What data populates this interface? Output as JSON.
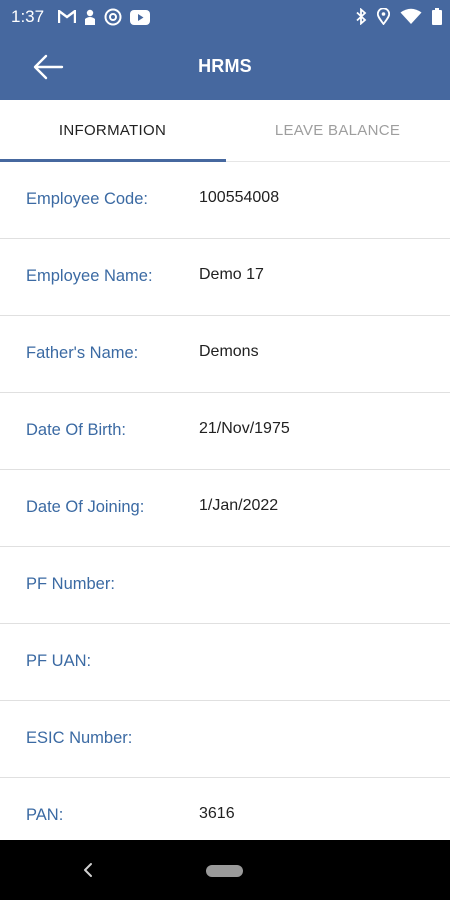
{
  "status_bar": {
    "time": "1:37",
    "left_icons": [
      "gmail-icon",
      "person-icon",
      "at-sign-icon",
      "youtube-icon"
    ],
    "right_icons": [
      "bluetooth-icon",
      "location-icon",
      "wifi-icon",
      "battery-icon"
    ]
  },
  "app_bar": {
    "title": "HRMS",
    "back_icon": "arrow-left-icon",
    "color": "#46689f"
  },
  "tabs": [
    {
      "label": "INFORMATION",
      "selected": true
    },
    {
      "label": "LEAVE BALANCE",
      "selected": false
    }
  ],
  "info_rows": [
    {
      "label": "Employee Code:",
      "value": "100554008"
    },
    {
      "label": "Employee Name:",
      "value": "Demo 17"
    },
    {
      "label": "Father's Name:",
      "value": "Demons"
    },
    {
      "label": "Date Of Birth:",
      "value": "21/Nov/1975"
    },
    {
      "label": "Date Of Joining:",
      "value": "1/Jan/2022"
    },
    {
      "label": "PF Number:",
      "value": ""
    },
    {
      "label": "PF UAN:",
      "value": ""
    },
    {
      "label": "ESIC Number:",
      "value": ""
    },
    {
      "label": "PAN:",
      "value": "3616"
    }
  ],
  "colors": {
    "primary": "#46689f",
    "label_text": "#3b6aa3",
    "value_text": "#212121",
    "inactive_tab": "#9e9e9e"
  }
}
